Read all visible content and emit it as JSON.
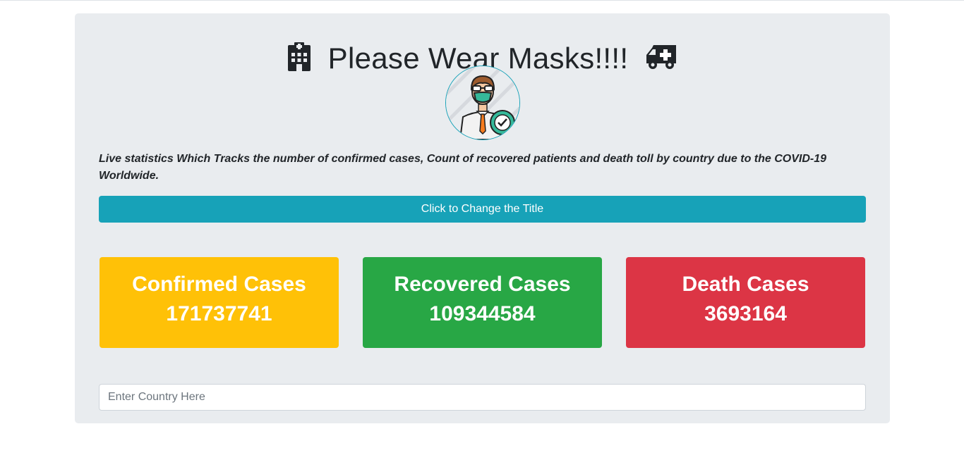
{
  "header": {
    "title": "Please Wear Masks!!!!",
    "left_icon": "hospital-icon",
    "right_icon": "ambulance-icon"
  },
  "avatar": {
    "icon": "masked-doctor-avatar"
  },
  "description": "Live statistics Which Tracks the number of confirmed cases, Count of recovered patients and death toll by country due to the COVID-19 Worldwide.",
  "change_title_button": {
    "label": "Click to Change the Title"
  },
  "stats": {
    "confirmed": {
      "label": "Confirmed Cases",
      "value": "171737741",
      "color": "#ffc107"
    },
    "recovered": {
      "label": "Recovered Cases",
      "value": "109344584",
      "color": "#28a745"
    },
    "death": {
      "label": "Death Cases",
      "value": "3693164",
      "color": "#dc3545"
    }
  },
  "search": {
    "placeholder": "Enter Country Here",
    "value": ""
  },
  "colors": {
    "accent": "#17a2b8",
    "panel_bg": "#e9ecef"
  }
}
